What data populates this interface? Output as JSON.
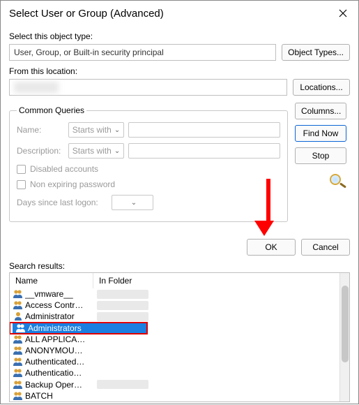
{
  "title": "Select User or Group (Advanced)",
  "labels": {
    "select_object_type": "Select this object type:",
    "object_type_value": "User, Group, or Built-in security principal",
    "object_types_btn": "Object Types...",
    "from_location": "From this location:",
    "locations_btn": "Locations...",
    "common_queries": "Common Queries",
    "name": "Name:",
    "description": "Description:",
    "starts_with": "Starts with",
    "disabled_accounts": "Disabled accounts",
    "non_expiring": "Non expiring password",
    "days_since": "Days since last logon:",
    "columns_btn": "Columns...",
    "find_now_btn": "Find Now",
    "stop_btn": "Stop",
    "ok_btn": "OK",
    "cancel_btn": "Cancel",
    "search_results": "Search results:",
    "col_name": "Name",
    "col_folder": "In Folder"
  },
  "results": [
    {
      "name": "__vmware__",
      "type": "group",
      "folder": true
    },
    {
      "name": "Access Contr…",
      "type": "group",
      "folder": true
    },
    {
      "name": "Administrator",
      "type": "user",
      "folder": true
    },
    {
      "name": "Administrators",
      "type": "group",
      "folder": false,
      "selected": true
    },
    {
      "name": "ALL APPLICA…",
      "type": "group",
      "folder": false
    },
    {
      "name": "ANONYMOU…",
      "type": "group",
      "folder": false
    },
    {
      "name": "Authenticated…",
      "type": "group",
      "folder": false
    },
    {
      "name": "Authenticatio…",
      "type": "group",
      "folder": false
    },
    {
      "name": "Backup Oper…",
      "type": "group",
      "folder": true
    },
    {
      "name": "BATCH",
      "type": "group",
      "folder": false
    }
  ]
}
